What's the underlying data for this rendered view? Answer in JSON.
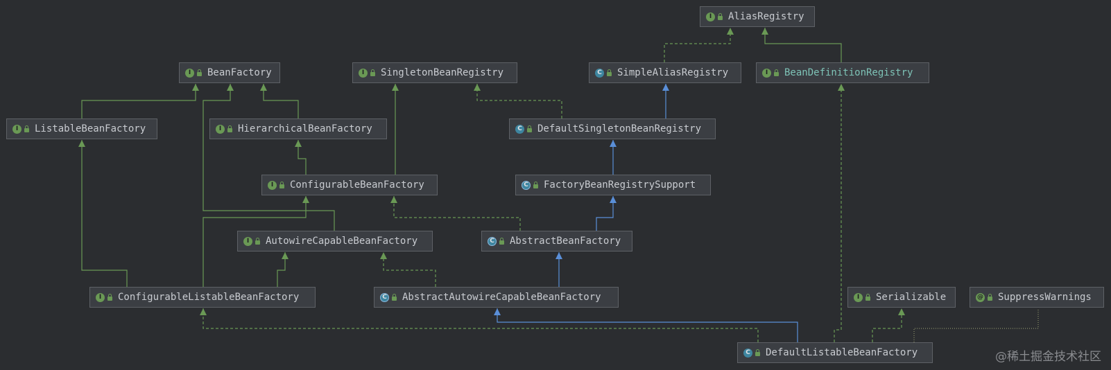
{
  "colors": {
    "background": "#2b2d30",
    "interface_edge": "#6a9955",
    "class_edge": "#5a8fd8",
    "annotation_edge": "#8a8f6a"
  },
  "nodes": {
    "alias_registry": {
      "label": "AliasRegistry",
      "kind": "interface"
    },
    "bean_factory": {
      "label": "BeanFactory",
      "kind": "interface"
    },
    "singleton_bean_registry": {
      "label": "SingletonBeanRegistry",
      "kind": "interface"
    },
    "simple_alias_registry": {
      "label": "SimpleAliasRegistry",
      "kind": "class"
    },
    "bean_definition_registry": {
      "label": "BeanDefinitionRegistry",
      "kind": "interface"
    },
    "listable_bean_factory": {
      "label": "ListableBeanFactory",
      "kind": "interface"
    },
    "hierarchical_bean_factory": {
      "label": "HierarchicalBeanFactory",
      "kind": "interface"
    },
    "default_singleton_bean_registry": {
      "label": "DefaultSingletonBeanRegistry",
      "kind": "class"
    },
    "configurable_bean_factory": {
      "label": "ConfigurableBeanFactory",
      "kind": "interface"
    },
    "factory_bean_registry_support": {
      "label": "FactoryBeanRegistrySupport",
      "kind": "abstract"
    },
    "autowire_capable_bean_factory": {
      "label": "AutowireCapableBeanFactory",
      "kind": "interface"
    },
    "abstract_bean_factory": {
      "label": "AbstractBeanFactory",
      "kind": "abstract"
    },
    "configurable_listable_bean_factory": {
      "label": "ConfigurableListableBeanFactory",
      "kind": "interface"
    },
    "abstract_autowire_capable_bean_factory": {
      "label": "AbstractAutowireCapableBeanFactory",
      "kind": "abstract"
    },
    "serializable": {
      "label": "Serializable",
      "kind": "interface"
    },
    "suppress_warnings": {
      "label": "SuppressWarnings",
      "kind": "annotation"
    },
    "default_listable_bean_factory": {
      "label": "DefaultListableBeanFactory",
      "kind": "class"
    }
  },
  "watermark": "@稀土掘金技术社区"
}
